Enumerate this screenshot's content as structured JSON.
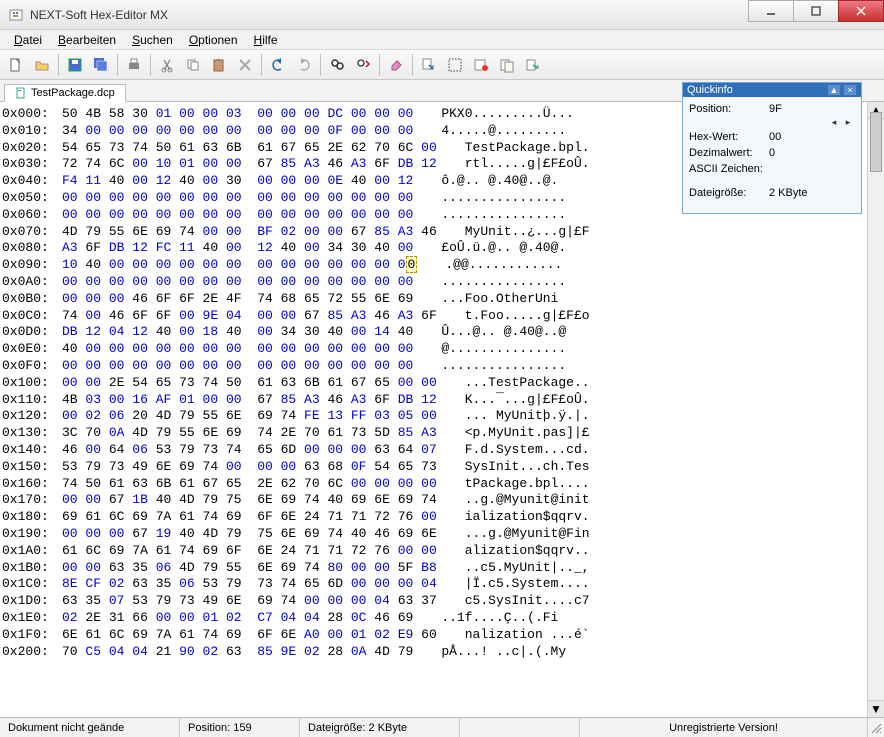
{
  "title": "NEXT-Soft Hex-Editor MX",
  "menu": {
    "datei": "Datei",
    "bearbeiten": "Bearbeiten",
    "suchen": "Suchen",
    "optionen": "Optionen",
    "hilfe": "Hilfe"
  },
  "tab": {
    "label": "TestPackage.dcp"
  },
  "quickinfo": {
    "title": "Quickinfo",
    "rows": {
      "position_k": "Position:",
      "position_v": "9F",
      "hex_k": "Hex-Wert:",
      "hex_v": "00",
      "dezimal_k": "Dezimalwert:",
      "dezimal_v": "0",
      "ascii_k": "ASCII Zeichen:",
      "ascii_v": "",
      "size_k": "Dateigröße:",
      "size_v": "2 KByte"
    }
  },
  "status": {
    "doc": "Dokument nicht geände",
    "pos": "Position: 159",
    "size": "Dateigröße: 2 KByte",
    "unreg": "Unregistrierte Version!"
  },
  "rows": [
    {
      "o": "0x000:",
      "h": "50 4B 58 30 01 00 00 03 00 00 00 DC 00 00 00",
      "a": "PKX0.........Ü..."
    },
    {
      "o": "0x010:",
      "h": "34 00 00 00 00 00 00 00 00 00 00 0F 00 00 00",
      "a": "4.....@........."
    },
    {
      "o": "0x020:",
      "h": "54 65 73 74 50 61 63 6B 61 67 65 2E 62 70 6C 00",
      "a": "TestPackage.bpl."
    },
    {
      "o": "0x030:",
      "h": "72 74 6C 00 10 01 00 00 67 85 A3 46 A3 6F DB 12",
      "a": "rtl.....g|£F£oÛ."
    },
    {
      "o": "0x040:",
      "h": "F4 11 40 00 12 40 00 30 00 00 00 0E 40 00 12",
      "a": "ô.@.. @.40@..@."
    },
    {
      "o": "0x050:",
      "h": "00 00 00 00 00 00 00 00 00 00 00 00 00 00 00",
      "a": "................"
    },
    {
      "o": "0x060:",
      "h": "00 00 00 00 00 00 00 00 00 00 00 00 00 00 00",
      "a": "................"
    },
    {
      "o": "0x070:",
      "h": "4D 79 55 6E 69 74 00 00 BF 02 00 00 67 85 A3 46",
      "a": "MyUnit..¿...g|£F"
    },
    {
      "o": "0x080:",
      "h": "A3 6F DB 12 FC 11 40 00 12 40 00 34 30 40 00",
      "a": "£oÛ.ü.@.. @.40@."
    },
    {
      "o": "0x090:",
      "h": "10 40 00 00 00 00 00 00 00 00 00 00 00 00 0",
      "himg": "0",
      "a": ".@@............"
    },
    {
      "o": "0x0A0:",
      "h": "00 00 00 00 00 00 00 00 00 00 00 00 00 00 00",
      "a": "................"
    },
    {
      "o": "0x0B0:",
      "h": "00 00 00 46 6F 6F 2E 4F 74 68 65 72 55 6E 69",
      "a": "...Foo.OtherUni"
    },
    {
      "o": "0x0C0:",
      "h": "74 00 46 6F 6F 00 9E 04 00 00 67 85 A3 46 A3 6F",
      "a": "t.Foo.....g|£F£o"
    },
    {
      "o": "0x0D0:",
      "h": "DB 12 04 12 40 00 18 40 00 34 30 40 00 14 40",
      "a": "Û...@.. @.40@..@"
    },
    {
      "o": "0x0E0:",
      "h": "40 00 00 00 00 00 00 00 00 00 00 00 00 00 00",
      "a": "@..............."
    },
    {
      "o": "0x0F0:",
      "h": "00 00 00 00 00 00 00 00 00 00 00 00 00 00 00",
      "a": "................"
    },
    {
      "o": "0x100:",
      "h": "00 00 2E 54 65 73 74 50 61 63 6B 61 67 65 00 00",
      "a": "...TestPackage.."
    },
    {
      "o": "0x110:",
      "h": "4B 03 00 16 AF 01 00 00 67 85 A3 46 A3 6F DB 12",
      "a": "K...¯...g|£F£oÛ."
    },
    {
      "o": "0x120:",
      "h": "00 02 06 20 4D 79 55 6E 69 74 FE 13 FF 03 05 00",
      "a": "... MyUnitþ.ÿ.|."
    },
    {
      "o": "0x130:",
      "h": "3C 70 0A 4D 79 55 6E 69 74 2E 70 61 73 5D 85 A3",
      "a": "<p.MyUnit.pas]|£"
    },
    {
      "o": "0x140:",
      "h": "46 00 64 06 53 79 73 74 65 6D 00 00 00 63 64 07",
      "a": "F.d.System...cd."
    },
    {
      "o": "0x150:",
      "h": "53 79 73 49 6E 69 74 00 00 00 63 68 0F 54 65 73",
      "a": "SysInit...ch.Tes"
    },
    {
      "o": "0x160:",
      "h": "74 50 61 63 6B 61 67 65 2E 62 70 6C 00 00 00 00",
      "a": "tPackage.bpl...."
    },
    {
      "o": "0x170:",
      "h": "00 00 67 1B 40 4D 79 75 6E 69 74 40 69 6E 69 74",
      "a": "..g.@Myunit@init"
    },
    {
      "o": "0x180:",
      "h": "69 61 6C 69 7A 61 74 69 6F 6E 24 71 71 72 76 00",
      "a": "ialization$qqrv."
    },
    {
      "o": "0x190:",
      "h": "00 00 00 67 19 40 4D 79 75 6E 69 74 40 46 69 6E",
      "a": "...g.@Myunit@Fin"
    },
    {
      "o": "0x1A0:",
      "h": "61 6C 69 7A 61 74 69 6F 6E 24 71 71 72 76 00 00",
      "a": "alization$qqrv.."
    },
    {
      "o": "0x1B0:",
      "h": "00 00 63 35 06 4D 79 55 6E 69 74 80 00 00 5F B8",
      "a": "..c5.MyUnit|.._,"
    },
    {
      "o": "0x1C0:",
      "h": "8E CF 02 63 35 06 53 79 73 74 65 6D 00 00 00 04",
      "a": "|Ï.c5.System...."
    },
    {
      "o": "0x1D0:",
      "h": "63 35 07 53 79 73 49 6E 69 74 00 00 00 04 63 37",
      "a": "c5.SysInit....c7"
    },
    {
      "o": "0x1E0:",
      "h": "02 2E 31 66 00 00 01 02 C7 04 04 28 0C 46 69",
      "a": "..1f....Ç..(.Fi"
    },
    {
      "o": "0x1F0:",
      "h": "6E 61 6C 69 7A 61 74 69 6F 6E A0 00 01 02 E9 60",
      "a": "nalization ...é`"
    },
    {
      "o": "0x200:",
      "h": "70 C5 04 04 21 90 02 63 85 9E 02 28 0A 4D 79",
      "a": "pÅ...! ..c|.(.My"
    }
  ]
}
